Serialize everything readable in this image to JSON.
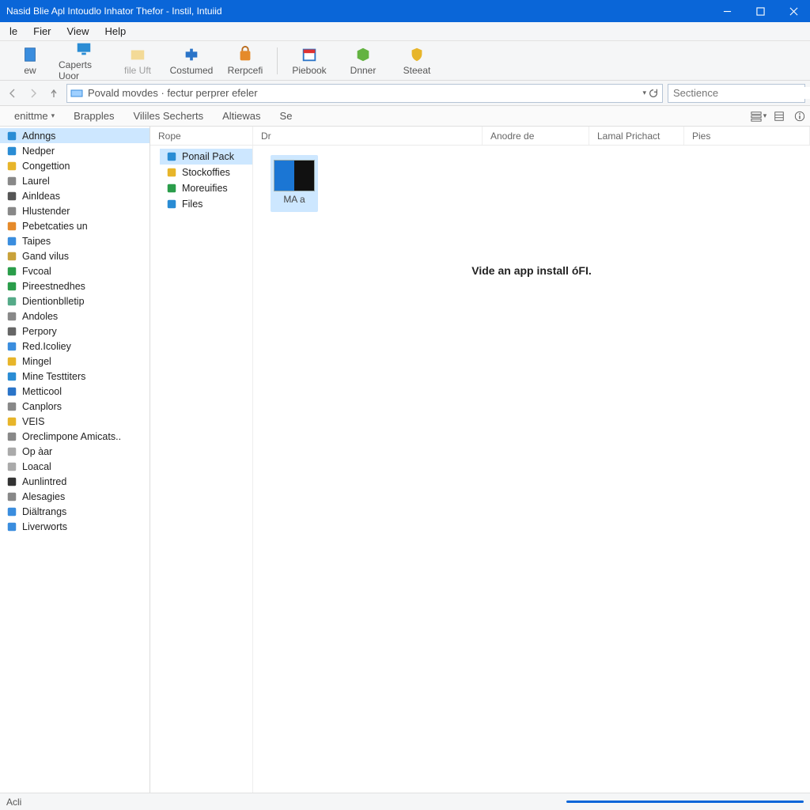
{
  "titlebar": {
    "title": "Nasid Blie Apl Intoudlo Inhator Thefor - Instil, Intuiid"
  },
  "menu": {
    "file": "le",
    "fier": "Fier",
    "view": "View",
    "help": "Help"
  },
  "toolbar": {
    "items": [
      {
        "label": "ew"
      },
      {
        "label": "Caperts Uoor"
      },
      {
        "label": "file Uft"
      },
      {
        "label": "Costumed"
      },
      {
        "label": "Rerpcefi"
      },
      {
        "sep": true
      },
      {
        "label": "Piebook"
      },
      {
        "label": "Dnner"
      },
      {
        "label": "Steeat"
      }
    ]
  },
  "addressbar": {
    "path": "Povald movdes · fectur perprer efeler"
  },
  "searchbar": {
    "placeholder": "Sectience"
  },
  "tabsrow": {
    "tabs": [
      {
        "label": "enittme",
        "dropdown": true
      },
      {
        "label": "Brapples"
      },
      {
        "label": "Vililes Secherts"
      },
      {
        "label": "Altiewas"
      },
      {
        "label": "Se"
      }
    ]
  },
  "sidebar1": {
    "items": [
      {
        "label": "Adnngs",
        "selected": true,
        "icon": "globe"
      },
      {
        "label": "Nedper",
        "icon": "n"
      },
      {
        "label": "Congettion",
        "icon": "note"
      },
      {
        "label": "Laurel",
        "icon": "disk"
      },
      {
        "label": "Ainldeas",
        "icon": "rows"
      },
      {
        "label": "Hlustender",
        "icon": "input"
      },
      {
        "label": "Pebetcaties un",
        "icon": "pie"
      },
      {
        "label": "Taipes",
        "icon": "swap"
      },
      {
        "label": "Gand vilus",
        "icon": "folder-o"
      },
      {
        "label": "Fvcoal",
        "icon": "play"
      },
      {
        "label": "Pireestnedhes",
        "icon": "leaf"
      },
      {
        "label": "Dientionblletip",
        "icon": "bars"
      },
      {
        "label": "Andoles",
        "icon": "disk"
      },
      {
        "label": "Perpory",
        "icon": "box"
      },
      {
        "label": "Red.Icoliey",
        "icon": "wrench"
      },
      {
        "label": "Mingel",
        "icon": "folder"
      },
      {
        "label": "Mine Testtiters",
        "icon": "dot"
      },
      {
        "label": "Metticool",
        "icon": "block"
      },
      {
        "label": "Canplors",
        "icon": "disk"
      },
      {
        "label": "VEIS",
        "icon": "up"
      },
      {
        "label": "Oreclimpone Amicats..",
        "icon": "ring"
      },
      {
        "label": "Op àar",
        "icon": "sq"
      },
      {
        "label": "Loacal",
        "icon": "sq"
      },
      {
        "label": "Aunlintred",
        "icon": "pen"
      },
      {
        "label": "Alesagies",
        "icon": "ring"
      },
      {
        "label": "Diältrangs",
        "icon": "stack"
      },
      {
        "label": "Liverworts",
        "icon": "stack"
      }
    ]
  },
  "columns": {
    "c1": "Rope",
    "c2": "Dr",
    "c3": "Anodre de",
    "c4": "Lamal Prichact",
    "c5": "Pies"
  },
  "sidebar2": {
    "items": [
      {
        "label": "Ponail Pack",
        "selected": true,
        "icon": "pkg"
      },
      {
        "label": "Stockoffies",
        "icon": "chrome"
      },
      {
        "label": "Moreuifies",
        "icon": "bar"
      },
      {
        "label": "Files",
        "icon": "file"
      }
    ]
  },
  "content": {
    "thumb_label": "MA a",
    "center_message": "Vide an app install óFI."
  },
  "statusbar": {
    "left": "Acli"
  }
}
